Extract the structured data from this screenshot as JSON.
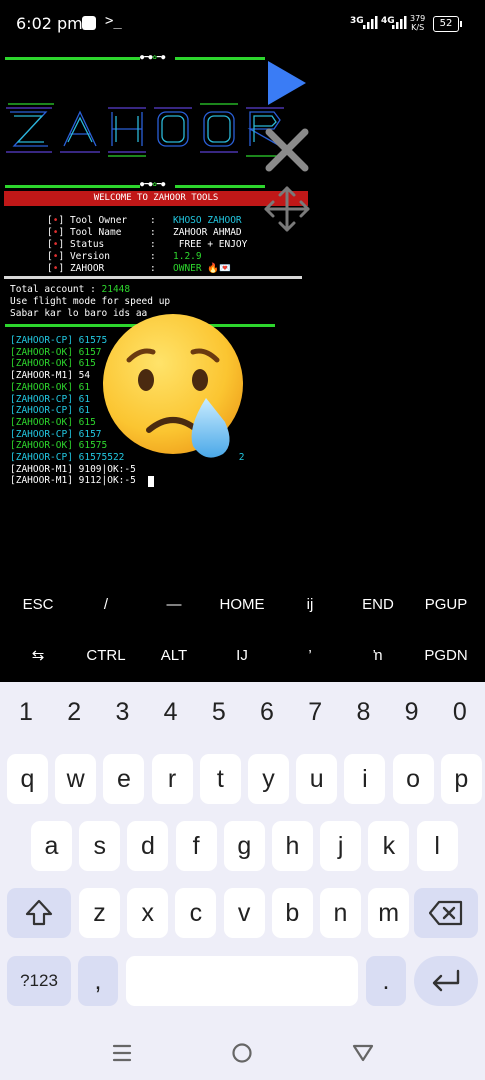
{
  "status_bar": {
    "time": "6:02 pm",
    "terminal_glyph": ">_",
    "sim1_label": "3G",
    "sim2_label": "4G",
    "net_speed_value": "379",
    "net_speed_unit": "K/S",
    "battery": "52"
  },
  "terminal": {
    "welcome": "WELCOME TO ZAHOOR TOOLS",
    "info": [
      {
        "label": "Tool Owner",
        "value": "KHOSO ZAHOOR",
        "color": "#22c7e0"
      },
      {
        "label": "Tool Name",
        "value": "ZAHOOR AHMAD",
        "color": "#ffffff"
      },
      {
        "label": "Status",
        "value": " FREE + ENJOY",
        "color": "#ffffff"
      },
      {
        "label": "Version",
        "value": "1.2.9",
        "color": "#2dd62d"
      },
      {
        "label": "ZAHOOR",
        "value": "OWNER 🔥💌",
        "color": "#2dd62d"
      }
    ],
    "total_label": "Total account : ",
    "total_value": "21448",
    "line_flight": "Use flight mode for speed up",
    "line_sabar": "Sabar kar lo baro ids aa",
    "logs": [
      {
        "text": "[ZAHOOR-CP] 61575",
        "color": "#22c7e0"
      },
      {
        "text": "[ZAHOOR-OK] 6157",
        "color": "#2dd62d"
      },
      {
        "text": "[ZAHOOR-OK] 615",
        "color": "#2dd62d"
      },
      {
        "text": "[ZAHOOR-M1] 54",
        "color": "#ffffff"
      },
      {
        "text": "[ZAHOOR-OK] 61",
        "color": "#2dd62d"
      },
      {
        "text": "[ZAHOOR-CP] 61",
        "color": "#22c7e0"
      },
      {
        "text": "[ZAHOOR-CP] 61",
        "color": "#22c7e0"
      },
      {
        "text": "[ZAHOOR-OK] 615",
        "color": "#2dd62d"
      },
      {
        "text": "[ZAHOOR-CP] 6157",
        "color": "#22c7e0"
      },
      {
        "text": "[ZAHOOR-OK] 61575",
        "color": "#2dd62d"
      },
      {
        "text": "[ZAHOOR-CP] 61575522                    2",
        "color": "#22c7e0"
      },
      {
        "text": "[ZAHOOR-M1] 9109|OK:-5",
        "color": "#ffffff"
      },
      {
        "text": "[ZAHOOR-M1] 9112|OK:-5",
        "color": "#ffffff"
      }
    ]
  },
  "extra_keys": {
    "row1": [
      "ESC",
      "/",
      "—",
      "HOME",
      "ij",
      "END",
      "PGUP"
    ],
    "row2": [
      "⇆",
      "CTRL",
      "ALT",
      "IJ",
      "’",
      "ŉ",
      "PGDN"
    ]
  },
  "keyboard": {
    "numbers": [
      "1",
      "2",
      "3",
      "4",
      "5",
      "6",
      "7",
      "8",
      "9",
      "0"
    ],
    "row1": [
      "q",
      "w",
      "e",
      "r",
      "t",
      "y",
      "u",
      "i",
      "o",
      "p"
    ],
    "row2": [
      "a",
      "s",
      "d",
      "f",
      "g",
      "h",
      "j",
      "k",
      "l"
    ],
    "row3": [
      "z",
      "x",
      "c",
      "v",
      "b",
      "n",
      "m"
    ],
    "symbols_label": "?123",
    "comma": ",",
    "period": "."
  },
  "colors": {
    "accent_green": "#2dd62d",
    "accent_cyan": "#22c7e0",
    "banner_red": "#c01818",
    "play_blue": "#3a7cf5",
    "keyboard_bg": "#eeeef8",
    "key_fn": "#d9ddf3"
  },
  "icons": {
    "play": "play-icon",
    "close": "close-icon",
    "move": "move-icon",
    "shift": "shift-icon",
    "backspace": "backspace-icon",
    "enter": "enter-icon",
    "nav_recents": "recents-icon",
    "nav_home": "home-icon",
    "nav_back": "back-icon",
    "emoji": "crying-face-emoji"
  }
}
